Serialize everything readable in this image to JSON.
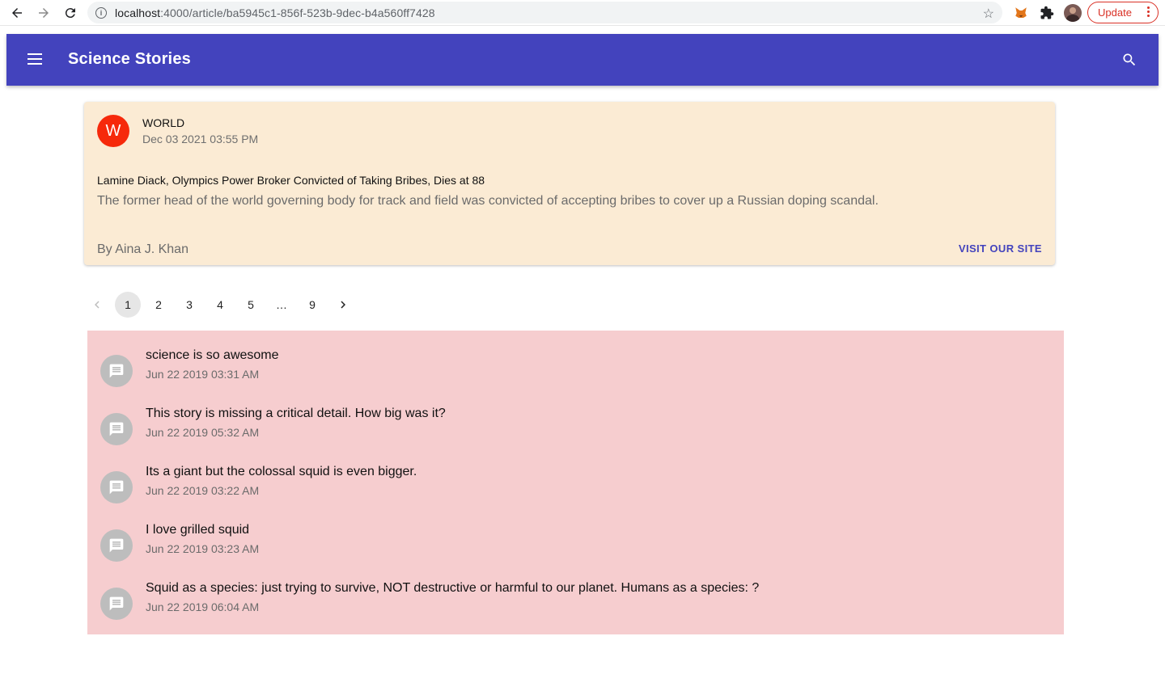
{
  "browser": {
    "url_host": "localhost",
    "url_path": ":4000/article/ba5945c1-856f-523b-9dec-b4a560ff7428",
    "update_label": "Update"
  },
  "app_bar": {
    "title": "Science Stories",
    "color": "#4343bd"
  },
  "article": {
    "avatar_letter": "W",
    "category": "WORLD",
    "date": "Dec 03 2021 03:55 PM",
    "headline": "Lamine Diack, Olympics Power Broker Convicted of Taking Bribes, Dies at 88",
    "summary": "The former head of the world governing body for track and field was convicted of accepting bribes to cover up a Russian doping scandal.",
    "byline": "By Aina J. Khan",
    "visit_label": "VISIT OUR SITE",
    "background": "#fbebd4",
    "avatar_color": "#f6290b"
  },
  "pagination": {
    "pages": [
      "1",
      "2",
      "3",
      "4",
      "5",
      "…",
      "9"
    ],
    "current": "1"
  },
  "comments": [
    {
      "text": "science is so awesome",
      "date": "Jun 22 2019 03:31 AM"
    },
    {
      "text": "This story is missing a critical detail. How big was it?",
      "date": "Jun 22 2019 05:32 AM"
    },
    {
      "text": "Its a giant but the colossal squid is even bigger.",
      "date": "Jun 22 2019 03:22 AM"
    },
    {
      "text": "I love grilled squid",
      "date": "Jun 22 2019 03:23 AM"
    },
    {
      "text": "Squid as a species: just trying to survive, NOT destructive or harmful to our planet. Humans as a species: ?",
      "date": "Jun 22 2019 06:04 AM"
    }
  ],
  "comments_background": "#f6cdcf"
}
